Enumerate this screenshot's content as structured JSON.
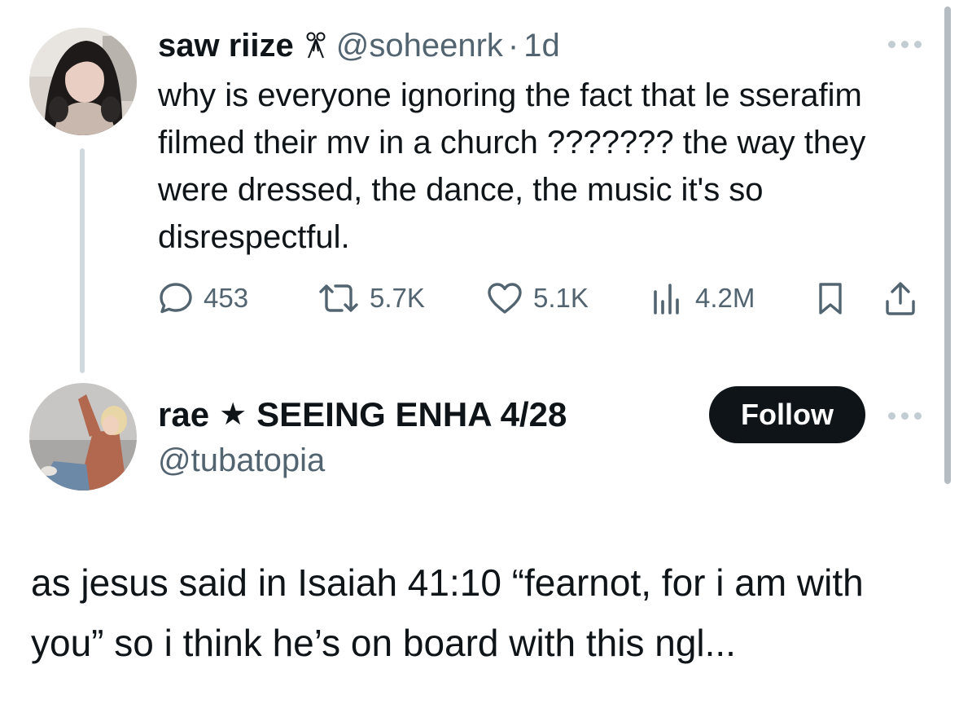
{
  "tweet": {
    "display_name": "saw riize",
    "name_emoji": "ribbon-icon",
    "handle": "@soheenrk",
    "separator": "·",
    "time": "1d",
    "text": "why is everyone ignoring the fact that le sserafim filmed their mv in a church ??????? the way they were dressed, the dance, the music it's so disrespectful.",
    "stats": {
      "replies": "453",
      "reposts": "5.7K",
      "likes": "5.1K",
      "views": "4.2M"
    }
  },
  "reply": {
    "display_name_part1": "rae",
    "star": "★",
    "display_name_part2": "SEEING ENHA 4/28",
    "handle": "@tubatopia",
    "follow_label": "Follow",
    "text": "as jesus said in Isaiah 41:10 “fearnot, for i am with you” so i think he’s on board with this ngl..."
  },
  "colors": {
    "text": "#0f1419",
    "secondary": "#536471",
    "thread_line": "#cfd9de",
    "follow_bg": "#0f1419"
  }
}
